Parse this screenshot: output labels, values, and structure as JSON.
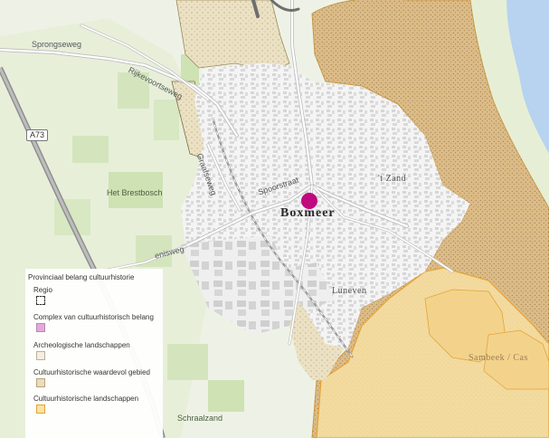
{
  "map": {
    "place_labels": {
      "town": "Boxmeer",
      "district_zand": "'t Zand",
      "district_luneven": "Luneven",
      "brestbosch": "Het Brestbosch",
      "schraalzand": "Schraalzand",
      "sambeek": "Sambeek / Cas"
    },
    "road_labels": {
      "sprongseweg": "Sprongseweg",
      "rijkevoortseweg": "Rijkevoortseweg",
      "spoorstraat": "Spoorstraat",
      "graafseweg": "Graafseweg",
      "holtheweg": "enisweg"
    },
    "highway_shield": "A73",
    "marker": {
      "name": "location-marker",
      "color": "#c0087f"
    }
  },
  "legend": {
    "title": "Provinciaal belang cultuurhistorie",
    "items": [
      {
        "label": "Regio",
        "color": "#ffffff",
        "border": "#333333",
        "style": "dashed"
      },
      {
        "label": "Complex van cultuurhistorisch belang",
        "color": "#e3a9d8",
        "border": "#b98bb2",
        "style": "solid"
      },
      {
        "label": "Archeologische landschappen",
        "color": "#f4efe2",
        "border": "#b9b09a",
        "style": "solid"
      },
      {
        "label": "Cultuurhistorische waardevol gebied",
        "color": "#eadcc0",
        "border": "#b9a27a",
        "style": "solid"
      },
      {
        "label": "Cultuurhistorische landschappen",
        "color": "#fbe2a4",
        "border": "#e3a437",
        "style": "solid"
      }
    ]
  },
  "colors": {
    "background": "#eef2e6",
    "urban": "#f3f3f3",
    "building": "#d9d9d9",
    "road": "#ffffff",
    "road_major": "#c9c9c9",
    "green_field": "#d6e6bf",
    "forest": "#c9dfb0",
    "water": "#b8d3ef",
    "brown_area": "#d9b985",
    "yellow_area": "#f7e3a8",
    "orange_border": "#e3a437"
  }
}
